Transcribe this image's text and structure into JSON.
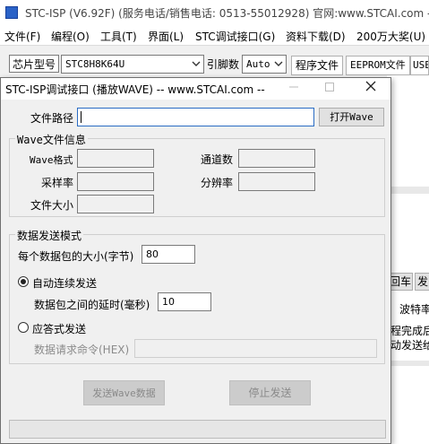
{
  "app": {
    "title": "STC-ISP (V6.92F) (服务电话/销售电话: 0513-55012928) 官网:www.STCAI.com  -- S",
    "menu": [
      "文件(F)",
      "编程(O)",
      "工具(T)",
      "界面(L)",
      "STC调试接口(G)",
      "资料下载(D)",
      "200万大奖(U)"
    ],
    "chip_label": "芯片型号",
    "chip_value": "STC8H8K64U",
    "pin_label": "引脚数",
    "pin_value": "Auto",
    "tabs": [
      "程序文件",
      "EEPROM文件",
      "USE"
    ],
    "right_panel": {
      "buttons": [
        "回车",
        "发"
      ],
      "baud_fragment": "波特率",
      "line1": "程完成后",
      "line2": "动发送给"
    }
  },
  "dialog": {
    "title": "STC-ISP调试接口 (播放WAVE) -- www.STCAI.com --",
    "close_icon": "close-icon",
    "file_path_label": "文件路径",
    "file_path_value": "",
    "open_button": "打开Wave",
    "info_group": "Wave文件信息",
    "format_label": "Wave格式",
    "format_value": "",
    "channels_label": "通道数",
    "channels_value": "",
    "sample_rate_label": "采样率",
    "sample_rate_value": "",
    "resolution_label": "分辨率",
    "resolution_value": "",
    "file_size_label": "文件大小",
    "file_size_value": "",
    "mode_group": "数据发送模式",
    "packet_size_label": "每个数据包的大小(字节)",
    "packet_size_value": "80",
    "auto_send_label": "自动连续发送",
    "auto_send_selected": true,
    "delay_label": "数据包之间的延时(毫秒)",
    "delay_value": "10",
    "answer_send_label": "应答式发送",
    "request_cmd_label": "数据请求命令(HEX)",
    "request_cmd_value": "",
    "send_button": "发送Wave数据",
    "stop_button": "停止发送"
  }
}
